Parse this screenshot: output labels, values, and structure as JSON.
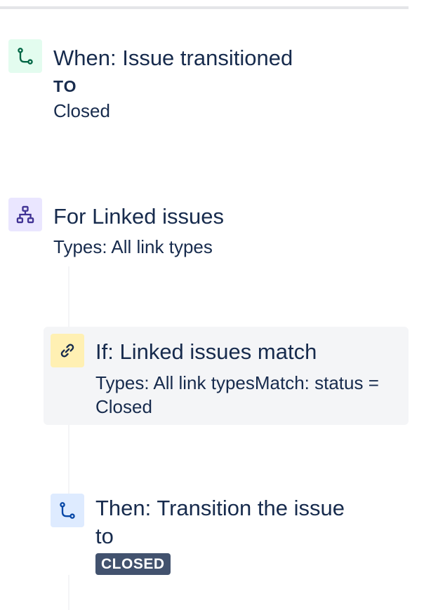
{
  "trigger": {
    "title": "When: Issue transitioned",
    "to_label": "TO",
    "to_value": "Closed",
    "icon": "transition-icon",
    "icon_bg": "#e3fcef",
    "icon_color": "#006644"
  },
  "branch": {
    "title": "For Linked issues",
    "detail": "Types: All link types",
    "icon": "branch-hierarchy-icon",
    "icon_bg": "#eae6ff",
    "icon_color": "#403294"
  },
  "condition": {
    "title": "If: Linked issues match",
    "detail": "Types: All link typesMatch: status = Closed",
    "icon": "link-icon",
    "icon_bg": "#fff0b3",
    "icon_color": "#172b4d"
  },
  "action": {
    "title": "Then: Transition the issue",
    "title_line2": "to",
    "status": "CLOSED",
    "icon": "transition-icon",
    "icon_bg": "#deebff",
    "icon_color": "#0747a6"
  }
}
